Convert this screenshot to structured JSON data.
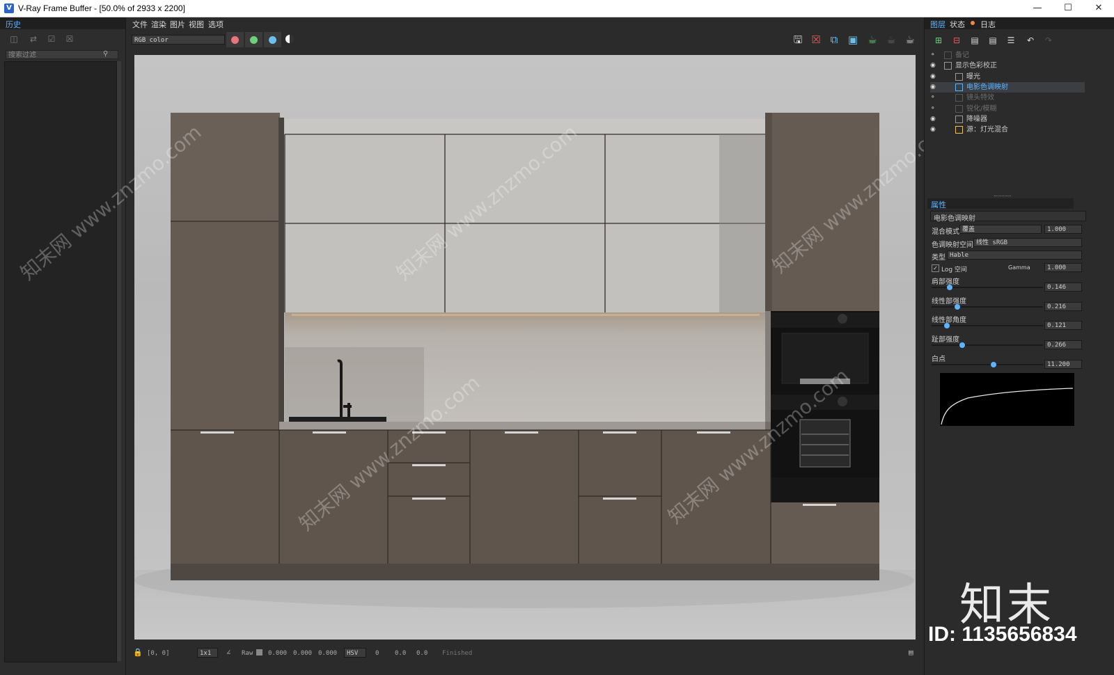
{
  "window": {
    "title": "V-Ray Frame Buffer - [50.0% of 2933 x 2200]",
    "app_icon": "vray-logo-icon",
    "controls": [
      "minimize-icon",
      "maximize-icon",
      "close-icon"
    ]
  },
  "left_panel": {
    "tab": "历史",
    "search_placeholder": "搜索过滤"
  },
  "menu": [
    "文件",
    "渲染",
    "图片",
    "视图",
    "选项"
  ],
  "toolbar": {
    "channel": "RGB color",
    "channel_colors": [
      "#e8747c",
      "#6dd17a",
      "#6bbfe9"
    ],
    "icons": [
      "save-icon",
      "clear-icon",
      "region-icon",
      "fit-icon",
      "render-icon",
      "stop-icon",
      "teapot-icon"
    ]
  },
  "status": {
    "coords": "[0, 0]",
    "zoom": "1x1",
    "mode": "Raw",
    "rgb": [
      "0.000",
      "0.000",
      "0.000"
    ],
    "color_mode": "HSV",
    "hsv": [
      "0",
      "0.0",
      "0.0"
    ],
    "state": "Finished"
  },
  "right_panel": {
    "tabs": [
      "图层",
      "状态",
      "日志"
    ],
    "layers": [
      {
        "label": "备记",
        "visible": false,
        "dim": true
      },
      {
        "label": "显示色彩校正",
        "visible": true,
        "dim": false
      },
      {
        "label": "曝光",
        "visible": true,
        "dim": false
      },
      {
        "label": "电影色调映射",
        "visible": true,
        "dim": false,
        "selected": true
      },
      {
        "label": "镜头特效",
        "visible": false,
        "dim": true
      },
      {
        "label": "锐化/模糊",
        "visible": false,
        "dim": true
      },
      {
        "label": "降噪器",
        "visible": true,
        "dim": false
      },
      {
        "label": "源：灯光混合",
        "visible": true,
        "dim": false
      }
    ],
    "properties": {
      "header": "属性",
      "layer_name": "电影色调映射",
      "blend_label": "混合模式",
      "blend_value": "覆盖",
      "blend_amount": "1.000",
      "space_label": "色调映射空间",
      "space_value": "线性 sRGB",
      "type_label": "类型",
      "type_value": "Hable",
      "log_label": "Log 空间",
      "gamma_label": "Gamma",
      "gamma_value": "1.000",
      "sliders": [
        {
          "label": "肩部强度",
          "value": "0.146",
          "fraction": 0.146
        },
        {
          "label": "线性部强度",
          "value": "0.216",
          "fraction": 0.216
        },
        {
          "label": "线性部角度",
          "value": "0.121",
          "fraction": 0.121
        },
        {
          "label": "趾部强度",
          "value": "0.266",
          "fraction": 0.266
        },
        {
          "label": "白点",
          "value": "11.200",
          "fraction": 0.56
        }
      ]
    }
  },
  "watermark": {
    "site": "知末网 www.znzmo.com",
    "brand": "知末",
    "id": "ID: 1135656834"
  }
}
